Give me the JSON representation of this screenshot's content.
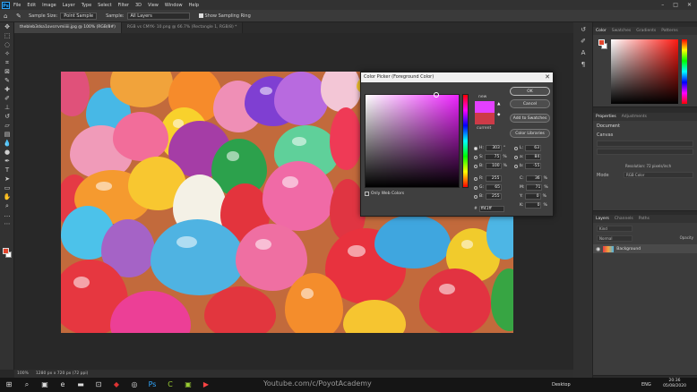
{
  "menubar": {
    "logo": "Ps",
    "items": [
      "File",
      "Edit",
      "Image",
      "Layer",
      "Type",
      "Select",
      "Filter",
      "3D",
      "View",
      "Window",
      "Help"
    ],
    "window_controls": [
      "–",
      "□",
      "✕"
    ]
  },
  "options": {
    "sample_size_label": "Sample Size:",
    "sample_size_value": "Point Sample",
    "sample_label": "Sample:",
    "sample_value": "All Layers",
    "show_ring_label": "Show Sampling Ring"
  },
  "tabs": [
    {
      "label": "thebleb3dsa1ovsrrvmiiiii.jpg @ 100% (RGB/8#)",
      "active": true
    },
    {
      "label": "RGB vs CMYK- 10.png @ 66.7% (Rectangle 1, RGB/8) *",
      "active": false
    }
  ],
  "statusbar": {
    "zoom": "100%",
    "info": "1280 px x 720 px (72 ppi)"
  },
  "picker": {
    "title": "Color Picker (Foreground Color)",
    "new_label": "new",
    "current_label": "current",
    "buttons": {
      "ok": "OK",
      "cancel": "Cancel",
      "add": "Add to Swatches",
      "libraries": "Color Libraries"
    },
    "only_web": "Only Web Colors",
    "hsb": [
      {
        "k": "H:",
        "v": "303",
        "u": "°"
      },
      {
        "k": "S:",
        "v": "75",
        "u": "%"
      },
      {
        "k": "B:",
        "v": "100",
        "u": "%"
      }
    ],
    "rgb": [
      {
        "k": "R:",
        "v": "255"
      },
      {
        "k": "G:",
        "v": "65"
      },
      {
        "k": "B:",
        "v": "255"
      }
    ],
    "lab": [
      {
        "k": "L:",
        "v": "63"
      },
      {
        "k": "a:",
        "v": "84"
      },
      {
        "k": "b:",
        "v": "-55"
      }
    ],
    "cmyk": [
      {
        "k": "C:",
        "v": "36",
        "u": "%"
      },
      {
        "k": "M:",
        "v": "71",
        "u": "%"
      },
      {
        "k": "Y:",
        "v": "0",
        "u": "%"
      },
      {
        "k": "K:",
        "v": "0",
        "u": "%"
      }
    ],
    "hex_label": "#",
    "hex": "ff41ff",
    "new_color": "#e340ff",
    "current_color": "#cd3a47"
  },
  "panels": {
    "color_tabs": [
      "Color",
      "Swatches",
      "Gradients",
      "Patterns"
    ],
    "props_tabs": [
      "Properties",
      "Adjustments"
    ],
    "props_doc": "Document",
    "props_canvas": "Canvas",
    "resolution": "Resolution: 72 pixels/inch",
    "mode": "Mode",
    "mode_value": "RGB Color",
    "layers_tabs": [
      "Layers",
      "Channels",
      "Paths"
    ],
    "layer_kind": "Kind",
    "layer_blend": "Normal",
    "layer_opacity": "Opacity",
    "layer_name": "Background"
  },
  "taskbar": {
    "watermark": "Youtube.com/c/PoyotAcademy",
    "desktop": "Desktop",
    "lang": "ENG",
    "time": "20:36",
    "date": "05/08/2020"
  }
}
